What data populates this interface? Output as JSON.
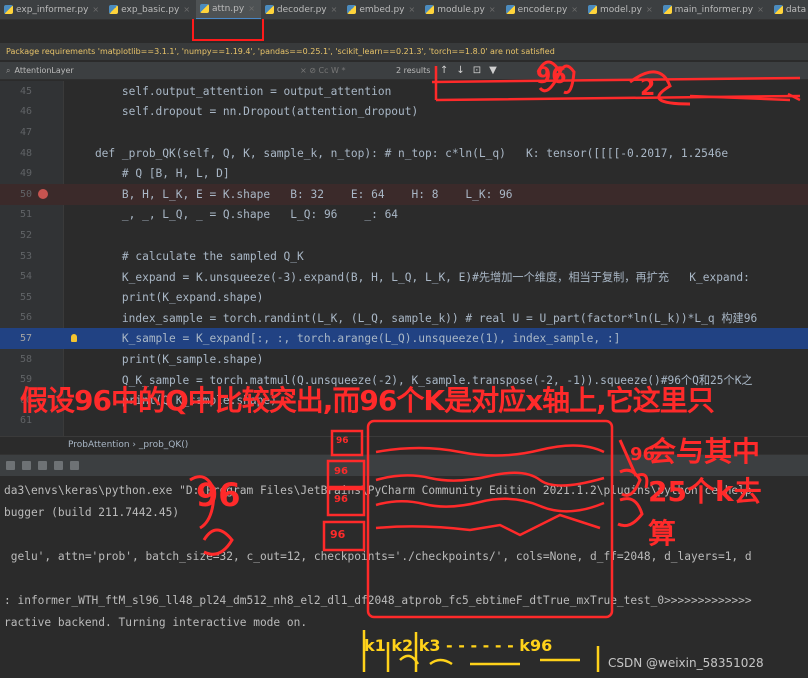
{
  "tabs": [
    {
      "label": "exp_informer.py",
      "active": false
    },
    {
      "label": "exp_basic.py",
      "active": false
    },
    {
      "label": "attn.py",
      "active": true
    },
    {
      "label": "decoder.py",
      "active": false
    },
    {
      "label": "embed.py",
      "active": false
    },
    {
      "label": "module.py",
      "active": false
    },
    {
      "label": "encoder.py",
      "active": false
    },
    {
      "label": "model.py",
      "active": false
    },
    {
      "label": "main_informer.py",
      "active": false
    },
    {
      "label": "data",
      "active": false
    }
  ],
  "warning": "Package requirements 'matplotlib==3.1.1', 'numpy==1.19.4', 'pandas==0.25.1', 'scikit_learn==0.21.3', 'torch==1.8.0' are not satisfied",
  "find": {
    "query": "AttentionLayer",
    "options": "×  ⊘  Cc  W  *",
    "results": "2 results"
  },
  "editor": {
    "lines": [
      {
        "n": "45",
        "code": "        self.output_attention = output_attention"
      },
      {
        "n": "46",
        "code": "        self.dropout = nn.Dropout(attention_dropout)"
      },
      {
        "n": "47",
        "code": ""
      },
      {
        "n": "48",
        "code": "    def _prob_QK(self, Q, K, sample_k, n_top): # n_top: c*ln(L_q)   K: tensor([[[[-0.2017, 1.2546e"
      },
      {
        "n": "49",
        "code": "        # Q [B, H, L, D]"
      },
      {
        "n": "50",
        "code": "        B, H, L_K, E = K.shape   B: 32    E: 64    H: 8    L_K: 96"
      },
      {
        "n": "51",
        "code": "        _, _, L_Q, _ = Q.shape   L_Q: 96    _: 64"
      },
      {
        "n": "52",
        "code": ""
      },
      {
        "n": "53",
        "code": "        # calculate the sampled Q_K"
      },
      {
        "n": "54",
        "code": "        K_expand = K.unsqueeze(-3).expand(B, H, L_Q, L_K, E)#先增加一个维度，相当于复制，再扩充   K_expand:"
      },
      {
        "n": "55",
        "code": "        print(K_expand.shape)"
      },
      {
        "n": "56",
        "code": "        index_sample = torch.randint(L_K, (L_Q, sample_k)) # real U = U_part(factor*ln(L_k))*L_q 构建96"
      },
      {
        "n": "57",
        "code": "        K_sample = K_expand[:, :, torch.arange(L_Q).unsqueeze(1), index_sample, :]"
      },
      {
        "n": "58",
        "code": "        print(K_sample.shape)"
      },
      {
        "n": "59",
        "code": "        Q_K_sample = torch.matmul(Q.unsqueeze(-2), K_sample.transpose(-2, -1)).squeeze()#96个Q和25个K之"
      },
      {
        "n": "60",
        "code": "        print(Q_K_sample.shape)"
      },
      {
        "n": "61",
        "code": ""
      },
      {
        "n": "62",
        "code": ""
      }
    ]
  },
  "breadcrumb": "ProbAttention  ›  _prob_QK()",
  "console": {
    "lines": [
      "da3\\envs\\keras\\python.exe \"D:\\Program Files\\JetBrains\\PyCharm Community Edition 2021.1.2\\plugins\\python-ce\\help",
      "bugger (build 211.7442.45)",
      "",
      " gelu', attn='prob', batch_size=32, c_out=12, checkpoints='./checkpoints/', cols=None, d_ff=2048, d_layers=1, d",
      "",
      ": informer_WTH_ftM_sl96_ll48_pl24_dm512_nh8_el2_dl1_df2048_atprob_fc5_ebtimeF_dtTrue_mxTrue_test_0>>>>>>>>>>>>>",
      "ractive backend. Turning interactive mode on."
    ]
  },
  "annotations": {
    "main_note": "假设96中的Q中比较突出,而96个K是对应x轴上,它这里只",
    "side_note_1": "会与其中",
    "side_note_2": "25个k去",
    "side_note_3": "算",
    "q_label": "96",
    "scribble_96": "96",
    "scribble_2": "2",
    "left_label": "96",
    "k_axis": "k1 k2 k3 - - -  - - - k96",
    "stack_top": "96",
    "stack_mid": "96",
    "stack_low": "96",
    "stack_bottom": "96",
    "ink_color": "#ff2a2a",
    "ink_yellow": "#ffd21a"
  },
  "watermark": "CSDN @weixin_58351028"
}
